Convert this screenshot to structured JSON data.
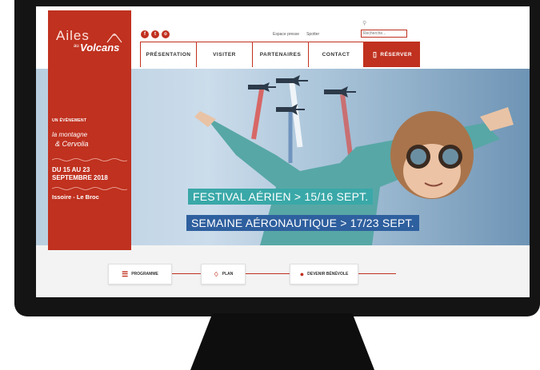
{
  "logo": {
    "ailes": "Ailes",
    "au": "au",
    "volcans": "Volcans"
  },
  "sidebar": {
    "event_label": "UN ÉVÉNEMENT",
    "partner_line1": "la montagne",
    "partner_line2": "& Cervolia",
    "dates_line1": "DU 15 AU 23",
    "dates_line2": "SEPTEMBRE 2018",
    "place": "Issoire - Le Broc"
  },
  "social": {
    "facebook": "f",
    "twitter": "t",
    "instagram": "o"
  },
  "toplinks": {
    "press": "Espace presse",
    "spotter": "Spotter"
  },
  "search": {
    "placeholder": "Recherche..."
  },
  "nav": {
    "presentation": "PRÉSENTATION",
    "visiter": "VISITER",
    "partenaires": "PARTENAIRES",
    "contact": "CONTACT",
    "reserver": "RÉSERVER"
  },
  "hero": {
    "banner1": "FESTIVAL AÉRIEN > 15/16 SEPT.",
    "banner2": "SEMAINE AÉRONAUTIQUE > 17/23 SEPT."
  },
  "quicklinks": {
    "programme": "PROGRAMME",
    "plan": "PLAN",
    "benevole": "DEVENIR BÉNÉVOLE"
  },
  "colors": {
    "brand": "#c0311f",
    "teal": "#3aa8a8",
    "blue": "#2e5f9e"
  }
}
